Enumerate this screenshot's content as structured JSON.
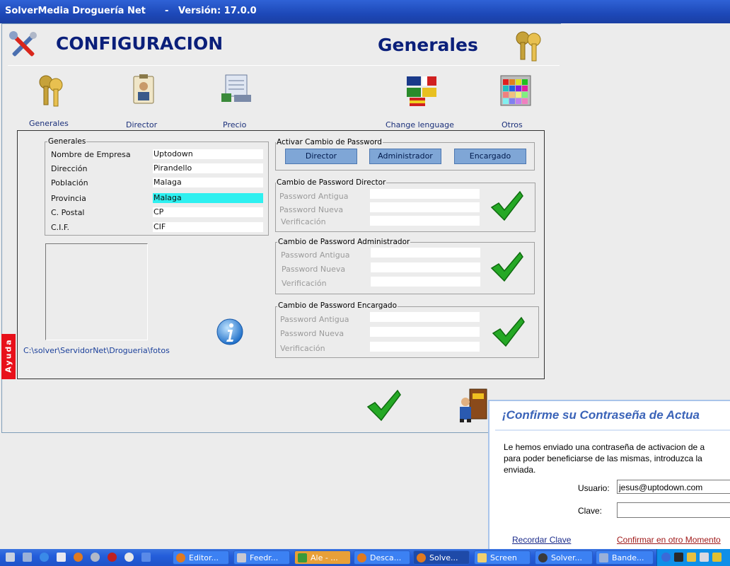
{
  "window": {
    "title": "SolverMedia Droguería Net      -   Versión: 17.0.0"
  },
  "header": {
    "title": "CONFIGURACION",
    "section": "Generales"
  },
  "nav": [
    {
      "label": "Generales",
      "icon": "keys-icon"
    },
    {
      "label": "Director",
      "icon": "badge-icon"
    },
    {
      "label": "Precio",
      "icon": "price-icon"
    },
    {
      "label": "Change lenguage",
      "icon": "flags-icon"
    },
    {
      "label": "Otros",
      "icon": "palette-icon"
    }
  ],
  "generales": {
    "legend": "Generales",
    "fields": [
      {
        "label": "Nombre de Empresa",
        "value": "Uptodown"
      },
      {
        "label": "Dirección",
        "value": "Pirandello"
      },
      {
        "label": "Población",
        "value": "Malaga"
      },
      {
        "label": "Provincia",
        "value": "Malaga"
      },
      {
        "label": "C. Postal",
        "value": "CP"
      },
      {
        "label": "C.I.F.",
        "value": "CIF"
      }
    ]
  },
  "photo_path": "C:\\solver\\ServidorNet\\Drogueria\\fotos",
  "side_tab": "Ayuda",
  "password_activation": {
    "legend": "Activar Cambio de Password",
    "buttons": [
      "Director",
      "Administrador",
      "Encargado"
    ]
  },
  "password_groups": [
    {
      "legend": "Cambio de Password Director"
    },
    {
      "legend": "Cambio de Password Administrador"
    },
    {
      "legend": "Cambio de Password Encargado"
    }
  ],
  "password_labels": [
    "Password Antigua",
    "Password Nueva",
    "Verificación"
  ],
  "dialog": {
    "title": "¡Confirme su Contraseña de Actua",
    "text_lines": [
      "Le hemos enviado una contraseña de activacion de a",
      "para poder beneficiarse de las mismas, introduzca la",
      "enviada."
    ],
    "user_label": "Usuario:",
    "user_value": "jesus@uptodown.com",
    "password_label": "Clave:",
    "remember_link": "Recordar Clave",
    "later_link": "Confirmar en otro Momento"
  },
  "taskbar": {
    "items": [
      "Editor...",
      "Feedr...",
      "Ale - ...",
      "Desca...",
      "Solve...",
      "Screen",
      "Solver...",
      "Bande..."
    ]
  },
  "colors": {
    "accent": "#0a1f7a",
    "highlight": "#2ef0f0",
    "button": "#7fa6d6",
    "check": "#1e9a1e"
  }
}
